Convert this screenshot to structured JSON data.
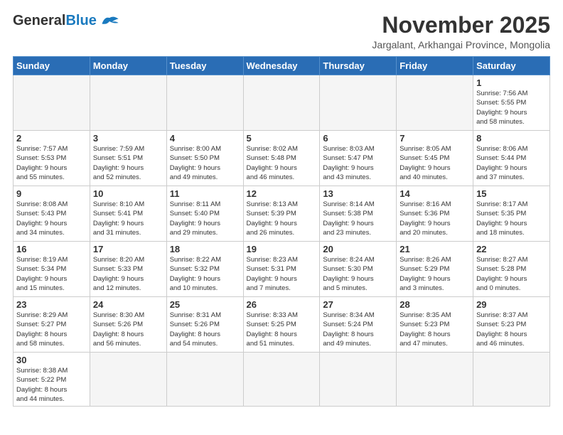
{
  "header": {
    "logo": {
      "general": "General",
      "blue": "Blue"
    },
    "title": "November 2025",
    "location": "Jargalant, Arkhangai Province, Mongolia"
  },
  "weekdays": [
    "Sunday",
    "Monday",
    "Tuesday",
    "Wednesday",
    "Thursday",
    "Friday",
    "Saturday"
  ],
  "weeks": [
    [
      {
        "day": "",
        "info": ""
      },
      {
        "day": "",
        "info": ""
      },
      {
        "day": "",
        "info": ""
      },
      {
        "day": "",
        "info": ""
      },
      {
        "day": "",
        "info": ""
      },
      {
        "day": "",
        "info": ""
      },
      {
        "day": "1",
        "info": "Sunrise: 7:56 AM\nSunset: 5:55 PM\nDaylight: 9 hours\nand 58 minutes."
      }
    ],
    [
      {
        "day": "2",
        "info": "Sunrise: 7:57 AM\nSunset: 5:53 PM\nDaylight: 9 hours\nand 55 minutes."
      },
      {
        "day": "3",
        "info": "Sunrise: 7:59 AM\nSunset: 5:51 PM\nDaylight: 9 hours\nand 52 minutes."
      },
      {
        "day": "4",
        "info": "Sunrise: 8:00 AM\nSunset: 5:50 PM\nDaylight: 9 hours\nand 49 minutes."
      },
      {
        "day": "5",
        "info": "Sunrise: 8:02 AM\nSunset: 5:48 PM\nDaylight: 9 hours\nand 46 minutes."
      },
      {
        "day": "6",
        "info": "Sunrise: 8:03 AM\nSunset: 5:47 PM\nDaylight: 9 hours\nand 43 minutes."
      },
      {
        "day": "7",
        "info": "Sunrise: 8:05 AM\nSunset: 5:45 PM\nDaylight: 9 hours\nand 40 minutes."
      },
      {
        "day": "8",
        "info": "Sunrise: 8:06 AM\nSunset: 5:44 PM\nDaylight: 9 hours\nand 37 minutes."
      }
    ],
    [
      {
        "day": "9",
        "info": "Sunrise: 8:08 AM\nSunset: 5:43 PM\nDaylight: 9 hours\nand 34 minutes."
      },
      {
        "day": "10",
        "info": "Sunrise: 8:10 AM\nSunset: 5:41 PM\nDaylight: 9 hours\nand 31 minutes."
      },
      {
        "day": "11",
        "info": "Sunrise: 8:11 AM\nSunset: 5:40 PM\nDaylight: 9 hours\nand 29 minutes."
      },
      {
        "day": "12",
        "info": "Sunrise: 8:13 AM\nSunset: 5:39 PM\nDaylight: 9 hours\nand 26 minutes."
      },
      {
        "day": "13",
        "info": "Sunrise: 8:14 AM\nSunset: 5:38 PM\nDaylight: 9 hours\nand 23 minutes."
      },
      {
        "day": "14",
        "info": "Sunrise: 8:16 AM\nSunset: 5:36 PM\nDaylight: 9 hours\nand 20 minutes."
      },
      {
        "day": "15",
        "info": "Sunrise: 8:17 AM\nSunset: 5:35 PM\nDaylight: 9 hours\nand 18 minutes."
      }
    ],
    [
      {
        "day": "16",
        "info": "Sunrise: 8:19 AM\nSunset: 5:34 PM\nDaylight: 9 hours\nand 15 minutes."
      },
      {
        "day": "17",
        "info": "Sunrise: 8:20 AM\nSunset: 5:33 PM\nDaylight: 9 hours\nand 12 minutes."
      },
      {
        "day": "18",
        "info": "Sunrise: 8:22 AM\nSunset: 5:32 PM\nDaylight: 9 hours\nand 10 minutes."
      },
      {
        "day": "19",
        "info": "Sunrise: 8:23 AM\nSunset: 5:31 PM\nDaylight: 9 hours\nand 7 minutes."
      },
      {
        "day": "20",
        "info": "Sunrise: 8:24 AM\nSunset: 5:30 PM\nDaylight: 9 hours\nand 5 minutes."
      },
      {
        "day": "21",
        "info": "Sunrise: 8:26 AM\nSunset: 5:29 PM\nDaylight: 9 hours\nand 3 minutes."
      },
      {
        "day": "22",
        "info": "Sunrise: 8:27 AM\nSunset: 5:28 PM\nDaylight: 9 hours\nand 0 minutes."
      }
    ],
    [
      {
        "day": "23",
        "info": "Sunrise: 8:29 AM\nSunset: 5:27 PM\nDaylight: 8 hours\nand 58 minutes."
      },
      {
        "day": "24",
        "info": "Sunrise: 8:30 AM\nSunset: 5:26 PM\nDaylight: 8 hours\nand 56 minutes."
      },
      {
        "day": "25",
        "info": "Sunrise: 8:31 AM\nSunset: 5:26 PM\nDaylight: 8 hours\nand 54 minutes."
      },
      {
        "day": "26",
        "info": "Sunrise: 8:33 AM\nSunset: 5:25 PM\nDaylight: 8 hours\nand 51 minutes."
      },
      {
        "day": "27",
        "info": "Sunrise: 8:34 AM\nSunset: 5:24 PM\nDaylight: 8 hours\nand 49 minutes."
      },
      {
        "day": "28",
        "info": "Sunrise: 8:35 AM\nSunset: 5:23 PM\nDaylight: 8 hours\nand 47 minutes."
      },
      {
        "day": "29",
        "info": "Sunrise: 8:37 AM\nSunset: 5:23 PM\nDaylight: 8 hours\nand 46 minutes."
      }
    ],
    [
      {
        "day": "30",
        "info": "Sunrise: 8:38 AM\nSunset: 5:22 PM\nDaylight: 8 hours\nand 44 minutes."
      },
      {
        "day": "",
        "info": ""
      },
      {
        "day": "",
        "info": ""
      },
      {
        "day": "",
        "info": ""
      },
      {
        "day": "",
        "info": ""
      },
      {
        "day": "",
        "info": ""
      },
      {
        "day": "",
        "info": ""
      }
    ]
  ]
}
